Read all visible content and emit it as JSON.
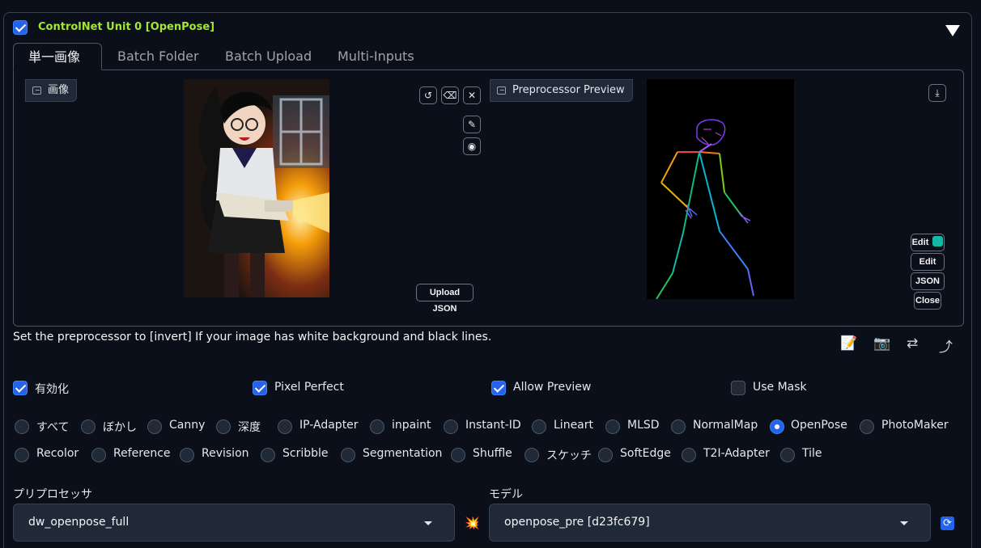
{
  "unit": {
    "enabled": true,
    "title": "ControlNet Unit 0  [OpenPose]"
  },
  "tabs": [
    {
      "label": "単一画像",
      "active": true
    },
    {
      "label": "Batch Folder",
      "active": false
    },
    {
      "label": "Batch Upload",
      "active": false
    },
    {
      "label": "Multi-Inputs",
      "active": false
    }
  ],
  "input_image": {
    "label": "画像",
    "tools": {
      "undo": "undo-icon",
      "erase": "eraser-icon",
      "clear": "close-icon",
      "brush": "brush-icon",
      "palette": "palette-icon"
    },
    "upload_json_label": "Upload JSON"
  },
  "preview": {
    "label": "Preprocessor Preview",
    "download_icon": "download-icon",
    "buttons": {
      "edit_photopea": "Edit",
      "edit": "Edit",
      "json": "JSON",
      "close": "Close"
    }
  },
  "hint": "Set the preprocessor to [invert] If your image has white background and black lines.",
  "toolbar_icons": [
    "notepad-icon",
    "camera-icon",
    "swap-icon",
    "send-arrow-icon"
  ],
  "options": [
    {
      "label": "有効化",
      "checked": true
    },
    {
      "label": "Pixel Perfect",
      "checked": true
    },
    {
      "label": "Allow Preview",
      "checked": true
    },
    {
      "label": "Use Mask",
      "checked": false
    }
  ],
  "control_types": {
    "row1": [
      "すべて",
      "ぼかし",
      "Canny",
      "深度",
      "IP-Adapter",
      "inpaint",
      "Instant-ID",
      "Lineart",
      "MLSD",
      "NormalMap",
      "OpenPose",
      "PhotoMaker"
    ],
    "row2": [
      "Recolor",
      "Reference",
      "Revision",
      "Scribble",
      "Segmentation",
      "Shuffle",
      "スケッチ",
      "SoftEdge",
      "T2I-Adapter",
      "Tile"
    ],
    "selected": "OpenPose"
  },
  "preprocessor": {
    "label": "プリプロセッサ",
    "value": "dw_openpose_full"
  },
  "run_preprocessor_icon": "explosion-icon",
  "model": {
    "label": "モデル",
    "value": "openpose_pre [d23fc679]"
  },
  "refresh_icon": "refresh-icon",
  "colors": {
    "accent": "#2563eb",
    "title": "#a3e635",
    "background": "#0b0f19"
  }
}
